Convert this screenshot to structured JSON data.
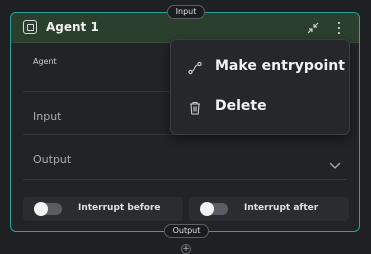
{
  "node": {
    "title": "Agent 1",
    "input_handle_label": "Input",
    "output_handle_label": "Output",
    "agent_field_label": "Agent",
    "input_label": "Input",
    "output_label": "Output",
    "toggles": [
      {
        "label": "Interrupt before",
        "on": false
      },
      {
        "label": "Interrupt after",
        "on": false
      }
    ]
  },
  "context_menu": {
    "items": [
      {
        "label": "Make entrypoint",
        "icon": "route-icon"
      },
      {
        "label": "Delete",
        "icon": "trash-icon"
      }
    ]
  },
  "colors": {
    "node_border": "#2aa39a",
    "header_bg": "#2b3f2e",
    "background": "#1e2024"
  }
}
